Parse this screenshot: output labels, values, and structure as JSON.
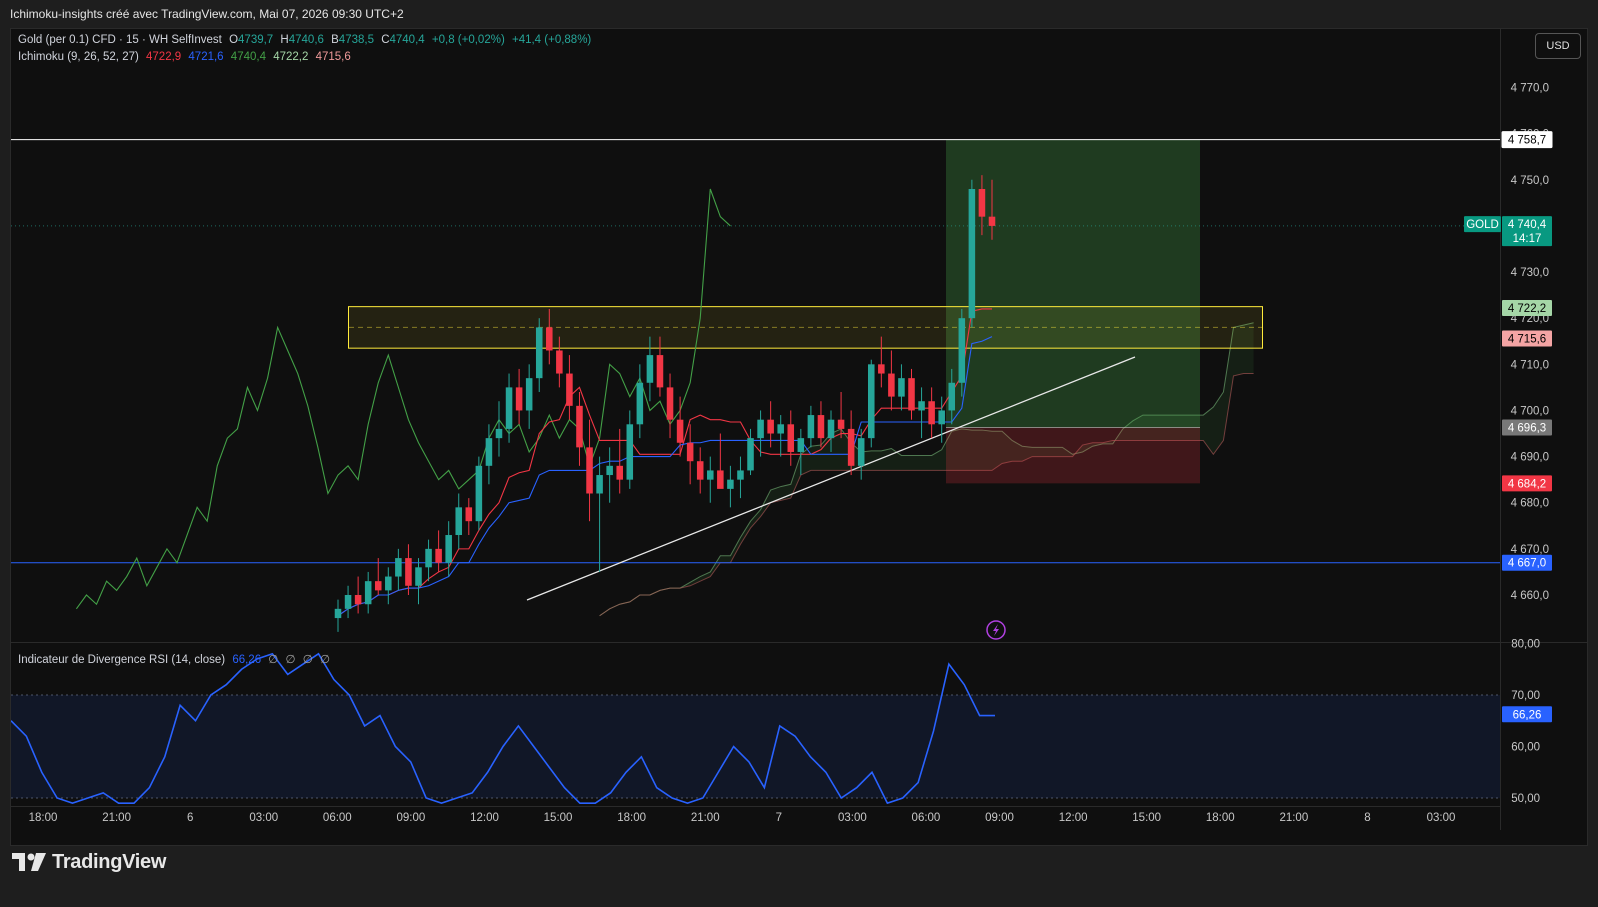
{
  "header": {
    "title": "Ichimoku-insights créé avec TradingView.com, Mai 07, 2026 09:30 UTC+2"
  },
  "legend": {
    "symbol": "Gold (per 0.1) CFD · 15 · WH SelfInvest",
    "o_label": "O",
    "o_value": "4739,7",
    "h_label": "H",
    "h_value": "4740,6",
    "b_label": "B",
    "b_value": "4738,5",
    "c_label": "C",
    "c_value": "4740,4",
    "change": "+0,8 (+0,02%)",
    "change2": "+41,4 (+0,88%)",
    "ichimoku_label": "Ichimoku (9, 26, 52, 27)",
    "ichimoku_values": [
      "4722,9",
      "4721,6",
      "4740,4",
      "4722,2",
      "4715,6"
    ],
    "rsi_label": "Indicateur de Divergence RSI (14, close)",
    "rsi_value": "66,26",
    "rsi_flags": [
      "∅",
      "∅",
      "∅",
      "∅"
    ]
  },
  "currency_button": "USD",
  "colors": {
    "up": "#26a69a",
    "down": "#f23645",
    "tenkan": "#f23645",
    "kijun": "#2962ff",
    "chikou": "#43a047",
    "cloud_up": "#4caf50",
    "cloud_down": "#8d3a3a",
    "rsi": "#2962ff",
    "zone": "#ffeb3b"
  },
  "brand": "TradingView",
  "price_tags": [
    {
      "text": "4 758,7",
      "style": "white"
    },
    {
      "text": "GOLD",
      "style": "green"
    },
    {
      "text": "4 740,4",
      "style": "green"
    },
    {
      "text": "14:17",
      "style": "green"
    },
    {
      "text": "4 722,2",
      "style": "lightgreen"
    },
    {
      "text": "4 715,6",
      "style": "pink"
    },
    {
      "text": "4 696,3",
      "style": "gray"
    },
    {
      "text": "4 684,2",
      "style": "red"
    },
    {
      "text": "4 667,0",
      "style": "blue"
    },
    {
      "text": "66,26",
      "style": "blue"
    }
  ],
  "chart_data": [
    {
      "type": "candlestick",
      "title": "Gold (per 0.1) CFD · 15 · WH SelfInvest",
      "y_ticks": [
        "4 770,0",
        "4 760,0",
        "4 750,0",
        "4 730,0",
        "4 720,0",
        "4 710,0",
        "4 700,0",
        "4 690,0",
        "4 680,0",
        "4 670,0",
        "4 660,0"
      ],
      "x_ticks": [
        "18:00",
        "21:00",
        "6",
        "03:00",
        "06:00",
        "09:00",
        "12:00",
        "15:00",
        "18:00",
        "21:00",
        "7",
        "03:00",
        "06:00",
        "09:00",
        "12:00",
        "15:00",
        "18:00",
        "21:00",
        "8",
        "03:00"
      ],
      "ylim": [
        4652,
        4781
      ],
      "grid": false,
      "horizontal_lines": [
        4758.7,
        4667.0
      ],
      "resistance_zone": [
        4713.5,
        4722.5
      ],
      "long_position": {
        "entry": 4696.3,
        "target": 4758.7,
        "stop": 4684.2
      },
      "trendline": [
        [
          4661,
          4713
        ],
        [
          4711
        ]
      ],
      "candles_ohlc": [
        [
          4655,
          4659,
          4652,
          4657
        ],
        [
          4657,
          4662,
          4655,
          4660
        ],
        [
          4660,
          4664,
          4656,
          4658
        ],
        [
          4658,
          4665,
          4656,
          4663
        ],
        [
          4663,
          4668,
          4660,
          4661
        ],
        [
          4661,
          4666,
          4658,
          4664
        ],
        [
          4664,
          4670,
          4661,
          4668
        ],
        [
          4668,
          4671,
          4660,
          4662
        ],
        [
          4662,
          4668,
          4658,
          4666
        ],
        [
          4666,
          4672,
          4663,
          4670
        ],
        [
          4670,
          4674,
          4665,
          4667
        ],
        [
          4667,
          4676,
          4664,
          4673
        ],
        [
          4673,
          4682,
          4670,
          4679
        ],
        [
          4679,
          4681,
          4673,
          4676
        ],
        [
          4676,
          4690,
          4674,
          4688
        ],
        [
          4688,
          4697,
          4684,
          4694
        ],
        [
          4694,
          4702,
          4690,
          4696
        ],
        [
          4696,
          4708,
          4693,
          4705
        ],
        [
          4705,
          4709,
          4697,
          4700
        ],
        [
          4700,
          4710,
          4696,
          4707
        ],
        [
          4707,
          4720,
          4704,
          4718
        ],
        [
          4718,
          4722,
          4710,
          4713
        ],
        [
          4713,
          4716,
          4705,
          4708
        ],
        [
          4708,
          4712,
          4698,
          4701
        ],
        [
          4701,
          4704,
          4688,
          4692
        ],
        [
          4692,
          4698,
          4676,
          4682
        ],
        [
          4682,
          4690,
          4665,
          4686
        ],
        [
          4686,
          4692,
          4680,
          4688
        ],
        [
          4688,
          4696,
          4682,
          4685
        ],
        [
          4685,
          4700,
          4683,
          4697
        ],
        [
          4697,
          4710,
          4694,
          4706
        ],
        [
          4706,
          4716,
          4702,
          4712
        ],
        [
          4712,
          4716,
          4703,
          4705
        ],
        [
          4705,
          4708,
          4694,
          4698
        ],
        [
          4698,
          4703,
          4690,
          4693
        ],
        [
          4693,
          4697,
          4684,
          4689
        ],
        [
          4689,
          4692,
          4682,
          4685
        ],
        [
          4685,
          4690,
          4680,
          4687
        ],
        [
          4687,
          4695,
          4684,
          4683
        ],
        [
          4683,
          4688,
          4679,
          4685
        ],
        [
          4685,
          4690,
          4681,
          4687
        ],
        [
          4687,
          4696,
          4686,
          4694
        ],
        [
          4694,
          4700,
          4690,
          4698
        ],
        [
          4698,
          4702,
          4692,
          4695
        ],
        [
          4695,
          4699,
          4690,
          4697
        ],
        [
          4697,
          4700,
          4688,
          4691
        ],
        [
          4691,
          4696,
          4686,
          4694
        ],
        [
          4694,
          4701,
          4692,
          4699
        ],
        [
          4699,
          4702,
          4692,
          4694
        ],
        [
          4694,
          4700,
          4691,
          4698
        ],
        [
          4698,
          4704,
          4694,
          4696
        ],
        [
          4696,
          4700,
          4686,
          4688
        ],
        [
          4688,
          4696,
          4685,
          4694
        ],
        [
          4694,
          4711,
          4692,
          4710
        ],
        [
          4710,
          4716,
          4705,
          4708
        ],
        [
          4708,
          4713,
          4700,
          4703
        ],
        [
          4703,
          4710,
          4700,
          4707
        ],
        [
          4707,
          4709,
          4698,
          4700
        ],
        [
          4700,
          4705,
          4694,
          4702
        ],
        [
          4702,
          4705,
          4694,
          4697
        ],
        [
          4697,
          4703,
          4693,
          4700
        ],
        [
          4700,
          4709,
          4697,
          4706
        ],
        [
          4706,
          4722,
          4703,
          4720
        ],
        [
          4720,
          4750,
          4718,
          4748
        ],
        [
          4748,
          4751,
          4738,
          4742
        ],
        [
          4742,
          4750,
          4737,
          4740
        ]
      ]
    },
    {
      "type": "line",
      "title": "Indicateur de Divergence RSI (14, close)",
      "y_ticks": [
        "80,00",
        "70,00",
        "60,00",
        "50,00"
      ],
      "ylim": [
        49,
        81
      ],
      "band": [
        50,
        70
      ],
      "series": [
        {
          "values": [
            65,
            62,
            55,
            50,
            49,
            50,
            51,
            49,
            49,
            52,
            58,
            68,
            65,
            70,
            72,
            75,
            77,
            78,
            74,
            76,
            78,
            73,
            70,
            64,
            66,
            60,
            57,
            50,
            49,
            50,
            51,
            55,
            60,
            64,
            60,
            56,
            52,
            49,
            49,
            51,
            55,
            58,
            52,
            50,
            49,
            50,
            55,
            60,
            57,
            52,
            64,
            62,
            58,
            55,
            50,
            52,
            55,
            49,
            50,
            53,
            63,
            76,
            72,
            66,
            66
          ]
        }
      ]
    }
  ]
}
